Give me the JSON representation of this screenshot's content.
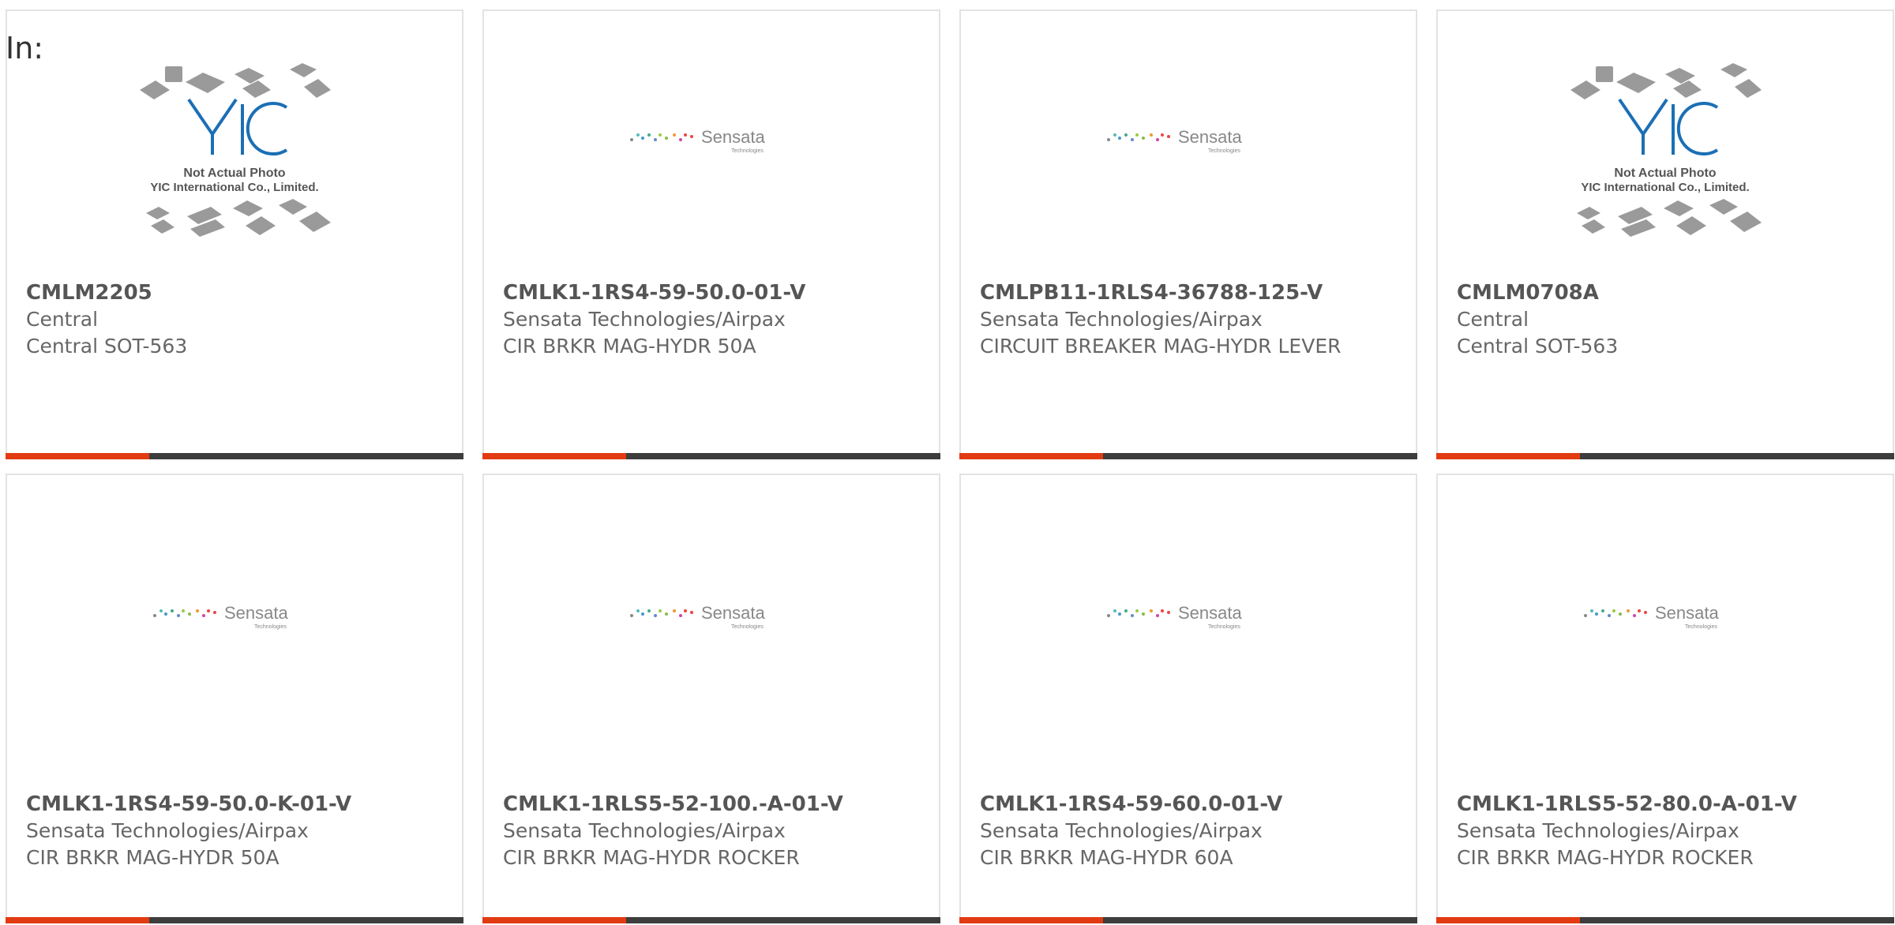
{
  "in_label": "In:",
  "colors": {
    "accent": "#e23b12",
    "bar": "#3d3d3d",
    "border": "#e3e3e3",
    "text": "#666666"
  },
  "yic_logo": {
    "brand": "YIC",
    "line1": "Not Actual Photo",
    "line2": "YIC International Co., Limited."
  },
  "sensata_logo": {
    "brand": "Sensata",
    "sub": "Technologies"
  },
  "products": [
    {
      "part": "CMLM2205",
      "maker": "Central",
      "desc": "Central SOT-563",
      "logo": "yic"
    },
    {
      "part": "CMLK1-1RS4-59-50.0-01-V",
      "maker": "Sensata Technologies/Airpax",
      "desc": "CIR BRKR MAG-HYDR 50A",
      "logo": "sensata"
    },
    {
      "part": "CMLPB11-1RLS4-36788-125-V",
      "maker": "Sensata Technologies/Airpax",
      "desc": "CIRCUIT BREAKER MAG-HYDR LEVER",
      "logo": "sensata"
    },
    {
      "part": "CMLM0708A",
      "maker": "Central",
      "desc": "Central SOT-563",
      "logo": "yic"
    },
    {
      "part": "CMLK1-1RS4-59-50.0-K-01-V",
      "maker": "Sensata Technologies/Airpax",
      "desc": "CIR BRKR MAG-HYDR 50A",
      "logo": "sensata"
    },
    {
      "part": "CMLK1-1RLS5-52-100.-A-01-V",
      "maker": "Sensata Technologies/Airpax",
      "desc": "CIR BRKR MAG-HYDR ROCKER",
      "logo": "sensata"
    },
    {
      "part": "CMLK1-1RS4-59-60.0-01-V",
      "maker": "Sensata Technologies/Airpax",
      "desc": "CIR BRKR MAG-HYDR 60A",
      "logo": "sensata"
    },
    {
      "part": "CMLK1-1RLS5-52-80.0-A-01-V",
      "maker": "Sensata Technologies/Airpax",
      "desc": "CIR BRKR MAG-HYDR ROCKER",
      "logo": "sensata"
    }
  ]
}
